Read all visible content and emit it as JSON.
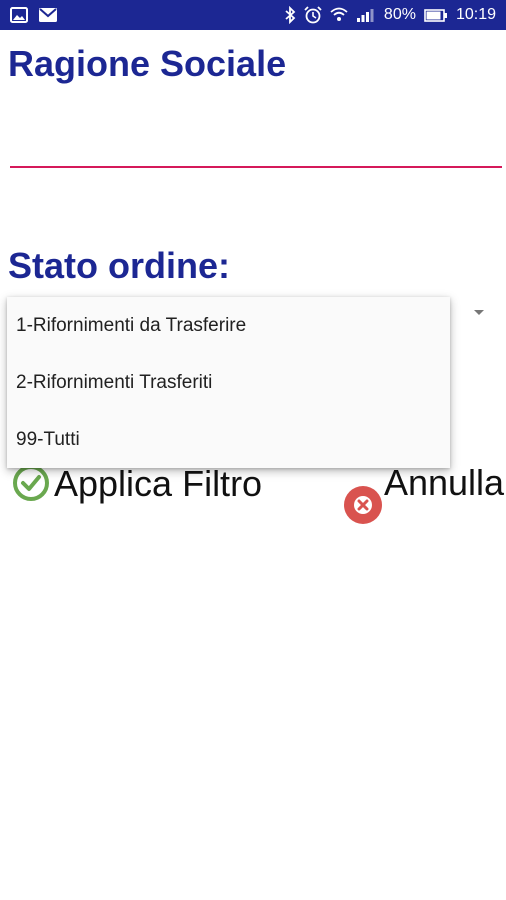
{
  "status_bar": {
    "battery_percent": "80%",
    "time": "10:19",
    "icons_left": [
      "image-icon",
      "mail-icon"
    ],
    "icons_right": [
      "bluetooth-icon",
      "alarm-icon",
      "wifi-icon",
      "signal-icon",
      "battery-icon"
    ]
  },
  "form": {
    "ragione_label": "Ragione Sociale",
    "ragione_value": "",
    "stato_label": "Stato ordine:"
  },
  "dropdown": {
    "options": [
      "1-Rifornimenti da Trasferire",
      "2-Rifornimenti Trasferiti",
      "99-Tutti"
    ]
  },
  "buttons": {
    "apply_label": "Applica Filtro",
    "cancel_label": "Annulla"
  },
  "colors": {
    "status_bar": "#1c2793",
    "title": "#1c2793",
    "input_underline": "#d5195a",
    "apply_icon": "#6aa84f",
    "cancel_icon": "#d9534f"
  }
}
